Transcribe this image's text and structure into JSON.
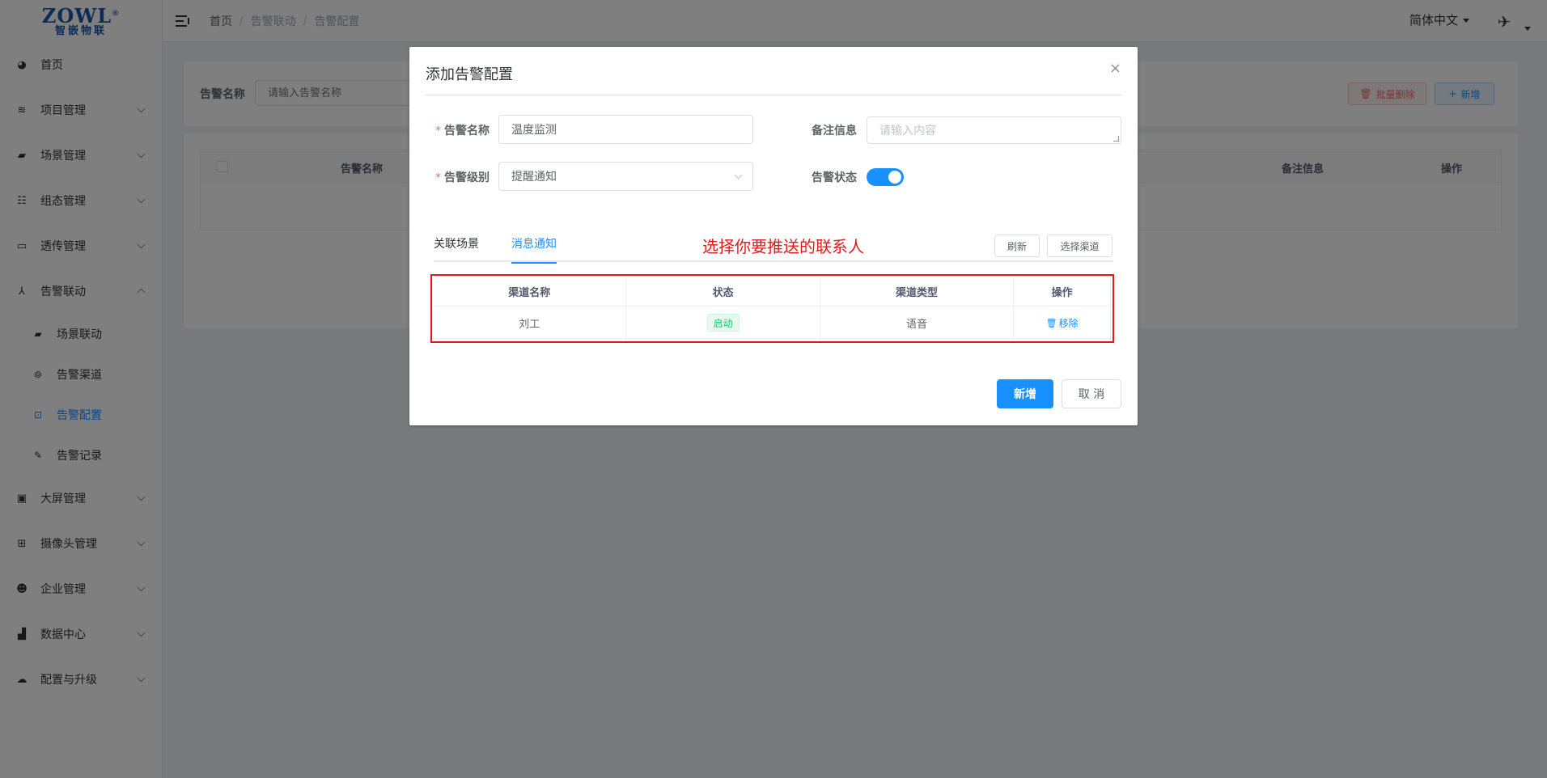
{
  "logo": {
    "top": "ZOWL",
    "reg": "®",
    "bottom": "智嵌物联"
  },
  "sidebar": {
    "items": [
      {
        "label": "首页",
        "icon": "dashboard-icon"
      },
      {
        "label": "项目管理",
        "icon": "layers-icon"
      },
      {
        "label": "场景管理",
        "icon": "clapper-icon"
      },
      {
        "label": "组态管理",
        "icon": "grid-list-icon"
      },
      {
        "label": "透传管理",
        "icon": "monitor-icon"
      },
      {
        "label": "告警联动",
        "icon": "network-icon"
      }
    ],
    "sub_items": [
      {
        "label": "场景联动",
        "icon": "clapper-icon"
      },
      {
        "label": "告警渠道",
        "icon": "channel-icon"
      },
      {
        "label": "告警配置",
        "icon": "lock-icon"
      },
      {
        "label": "告警记录",
        "icon": "edit-icon"
      }
    ],
    "items_after": [
      {
        "label": "大屏管理",
        "icon": "screen-icon"
      },
      {
        "label": "摄像头管理",
        "icon": "table-icon"
      },
      {
        "label": "企业管理",
        "icon": "user-gear-icon"
      },
      {
        "label": "数据中心",
        "icon": "bar-chart-icon"
      },
      {
        "label": "配置与升级",
        "icon": "cloud-upload-icon"
      }
    ]
  },
  "header": {
    "breadcrumb": [
      "首页",
      "告警联动",
      "告警配置"
    ],
    "breadcrumb_sep": "/",
    "language": "简体中文"
  },
  "search": {
    "label": "告警名称",
    "placeholder": "请输入告警名称",
    "batch_delete": "批量删除",
    "add": "新增"
  },
  "main_table": {
    "columns": [
      "告警名称",
      "备注信息",
      "操作"
    ]
  },
  "dialog": {
    "title": "添加告警配置",
    "close": "×",
    "fields": {
      "name_label": "告警名称",
      "name_value": "温度监测",
      "remark_label": "备注信息",
      "remark_placeholder": "请输入内容",
      "level_label": "告警级别",
      "level_value": "提醒通知",
      "status_label": "告警状态",
      "required_mark": "*",
      "status_on": true
    },
    "tabs": [
      "关联场景",
      "消息通知"
    ],
    "active_tab": "消息通知",
    "annotation": "选择你要推送的联系人",
    "refresh": "刷新",
    "select_channel": "选择渠道",
    "channel_table": {
      "columns": [
        "渠道名称",
        "状态",
        "渠道类型",
        "操作"
      ],
      "rows": [
        {
          "name": "刘工",
          "status": "启动",
          "type": "语音",
          "action": "移除"
        }
      ]
    },
    "confirm": "新增",
    "cancel": "取 消"
  },
  "colors": {
    "primary": "#1890ff",
    "danger": "#f56c6c",
    "success": "#13ce66",
    "annotation": "#e11b1b"
  }
}
